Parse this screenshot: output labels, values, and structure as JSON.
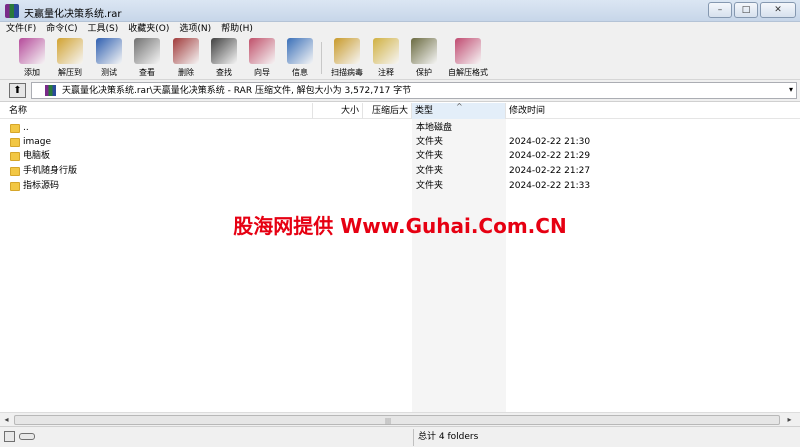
{
  "window": {
    "title": "天赢量化决策系统.rar",
    "buttons": [
      "–",
      "□",
      "✕"
    ]
  },
  "menu": [
    "文件(F)",
    "命令(C)",
    "工具(S)",
    "收藏夹(O)",
    "选项(N)",
    "帮助(H)"
  ],
  "toolbar": [
    {
      "label": "添加",
      "icon": "add-archive-icon",
      "color": "#b54a9a"
    },
    {
      "label": "解压到",
      "icon": "extract-to-icon",
      "color": "#d1a230"
    },
    {
      "label": "测试",
      "icon": "test-icon",
      "color": "#2f5fb0"
    },
    {
      "label": "查看",
      "icon": "view-glasses-icon",
      "color": "#707070"
    },
    {
      "label": "删除",
      "icon": "delete-icon",
      "color": "#a03a3a"
    },
    {
      "label": "查找",
      "icon": "find-binoculars-icon",
      "color": "#404040"
    },
    {
      "label": "向导",
      "icon": "wizard-icon",
      "color": "#c0506a"
    },
    {
      "label": "信息",
      "icon": "info-icon",
      "color": "#3a6fb8"
    },
    {
      "label": "扫描病毒",
      "icon": "virus-scan-icon",
      "color": "#c89a2a"
    },
    {
      "label": "注释",
      "icon": "comment-icon",
      "color": "#d0b040"
    },
    {
      "label": "保护",
      "icon": "protect-shield-icon",
      "color": "#6a6a40"
    },
    {
      "label": "自解压格式",
      "icon": "sfx-archive-icon",
      "color": "#c04a70"
    }
  ],
  "address": {
    "path": "天赢量化决策系统.rar\\天赢量化决策系统 - RAR 压缩文件, 解包大小为 3,572,717 字节",
    "drop_arrow": "▾",
    "up_arrow": "⬆"
  },
  "columns": [
    {
      "label": "名称",
      "key": "name"
    },
    {
      "label": "大小",
      "key": "size"
    },
    {
      "label": "压缩后大小",
      "key": "packed"
    },
    {
      "label": "类型",
      "key": "type",
      "sorted": true
    },
    {
      "label": "修改时间",
      "key": "modified"
    }
  ],
  "sort_indicator": "^",
  "files": [
    {
      "name": "..",
      "type": "本地磁盘",
      "modified": ""
    },
    {
      "name": "image",
      "type": "文件夹",
      "modified": "2024-02-22 21:30"
    },
    {
      "name": "电脑板",
      "type": "文件夹",
      "modified": "2024-02-22 21:29"
    },
    {
      "name": "手机随身行版",
      "type": "文件夹",
      "modified": "2024-02-22 21:27"
    },
    {
      "name": "指标源码",
      "type": "文件夹",
      "modified": "2024-02-22 21:33"
    }
  ],
  "watermark": "股海网提供 Www.Guhai.Com.CN",
  "scrollbar": {
    "left": "◂",
    "right": "▸",
    "grip": "|||"
  },
  "status": {
    "text": "总计 4 folders"
  }
}
